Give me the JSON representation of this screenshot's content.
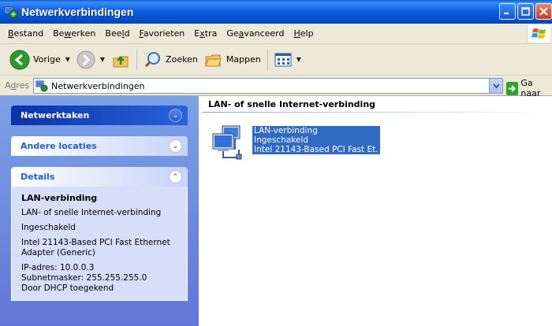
{
  "window": {
    "title": "Netwerkverbindingen"
  },
  "menu": {
    "items": [
      {
        "pre": "",
        "u": "B",
        "post": "estand"
      },
      {
        "pre": "Be",
        "u": "w",
        "post": "erken"
      },
      {
        "pre": "Bee",
        "u": "l",
        "post": "d"
      },
      {
        "pre": "",
        "u": "F",
        "post": "avorieten"
      },
      {
        "pre": "E",
        "u": "x",
        "post": "tra"
      },
      {
        "pre": "Ge",
        "u": "a",
        "post": "vanceerd"
      },
      {
        "pre": "",
        "u": "H",
        "post": "elp"
      }
    ]
  },
  "toolbar": {
    "back_label": "Vorige",
    "search_label": "Zoeken",
    "folders_label": "Mappen"
  },
  "address": {
    "label_pre": "A",
    "label_u": "d",
    "label_post": "res",
    "value": "Netwerkverbindingen",
    "go_label": "Ga naar"
  },
  "sidepane": {
    "network_tasks": "Netwerktaken",
    "other_places": "Andere locaties",
    "details_title": "Details",
    "details": {
      "name": "LAN-verbinding",
      "type": "LAN- of snelle Internet-verbinding",
      "status": "Ingeschakeld",
      "adapter": "Intel 21143-Based PCI Fast Ethernet Adapter (Generic)",
      "ip": "IP-adres: 10.0.0.3",
      "subnet": "Subnetmasker: 255.255.255.0",
      "dhcp": "Door DHCP toegekend"
    }
  },
  "content": {
    "group_title": "LAN- of snelle Internet-verbinding",
    "item": {
      "name": "LAN-verbinding",
      "status": "Ingeschakeld",
      "device": "Intel 21143-Based PCI Fast Et..."
    }
  },
  "colors": {
    "title_bar": "#0452d0",
    "selection": "#316ac5",
    "sidepane": "#7ba2e7"
  }
}
